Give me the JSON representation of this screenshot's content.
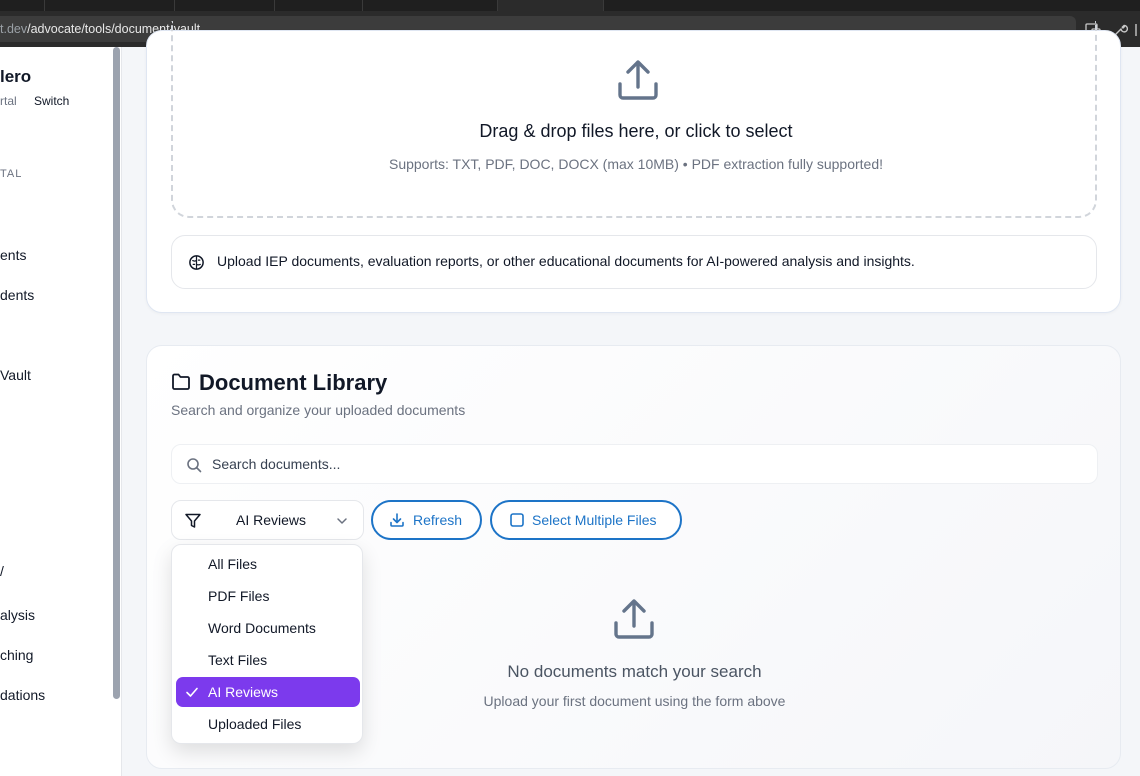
{
  "browser": {
    "url_prefix": "t.dev",
    "url_path": "/advocate/tools/document-vault"
  },
  "sidebar": {
    "user_name": "lero",
    "portal_label": "rtal",
    "switch_label": "Switch",
    "section_label": "TAL",
    "items": [
      {
        "label": "ents"
      },
      {
        "label": "dents"
      },
      {
        "label": "Vault"
      },
      {
        "label": "/"
      },
      {
        "label": "alysis"
      },
      {
        "label": "ching"
      },
      {
        "label": "dations"
      }
    ]
  },
  "upload": {
    "title": "Drag & drop files here, or click to select",
    "subtitle": "Supports: TXT, PDF, DOC, DOCX (max 10MB) • PDF extraction fully supported!",
    "info": "Upload IEP documents, evaluation reports, or other educational documents for AI-powered analysis and insights."
  },
  "library": {
    "title": "Document Library",
    "subtitle": "Search and organize your uploaded documents",
    "search_placeholder": "Search documents...",
    "filter_value": "AI Reviews",
    "refresh_label": "Refresh",
    "select_multiple_label": "Select Multiple Files",
    "empty_title": "No documents match your search",
    "empty_subtitle": "Upload your first document using the form above"
  },
  "filter_menu": {
    "options": [
      {
        "label": "All Files"
      },
      {
        "label": "PDF Files"
      },
      {
        "label": "Word Documents"
      },
      {
        "label": "Text Files"
      },
      {
        "label": "AI Reviews"
      },
      {
        "label": "Uploaded Files"
      }
    ],
    "selected": "AI Reviews"
  },
  "colors": {
    "accent_blue": "#1d74c7",
    "selected_purple": "#7c3aed",
    "icon_slate": "#64748b"
  }
}
